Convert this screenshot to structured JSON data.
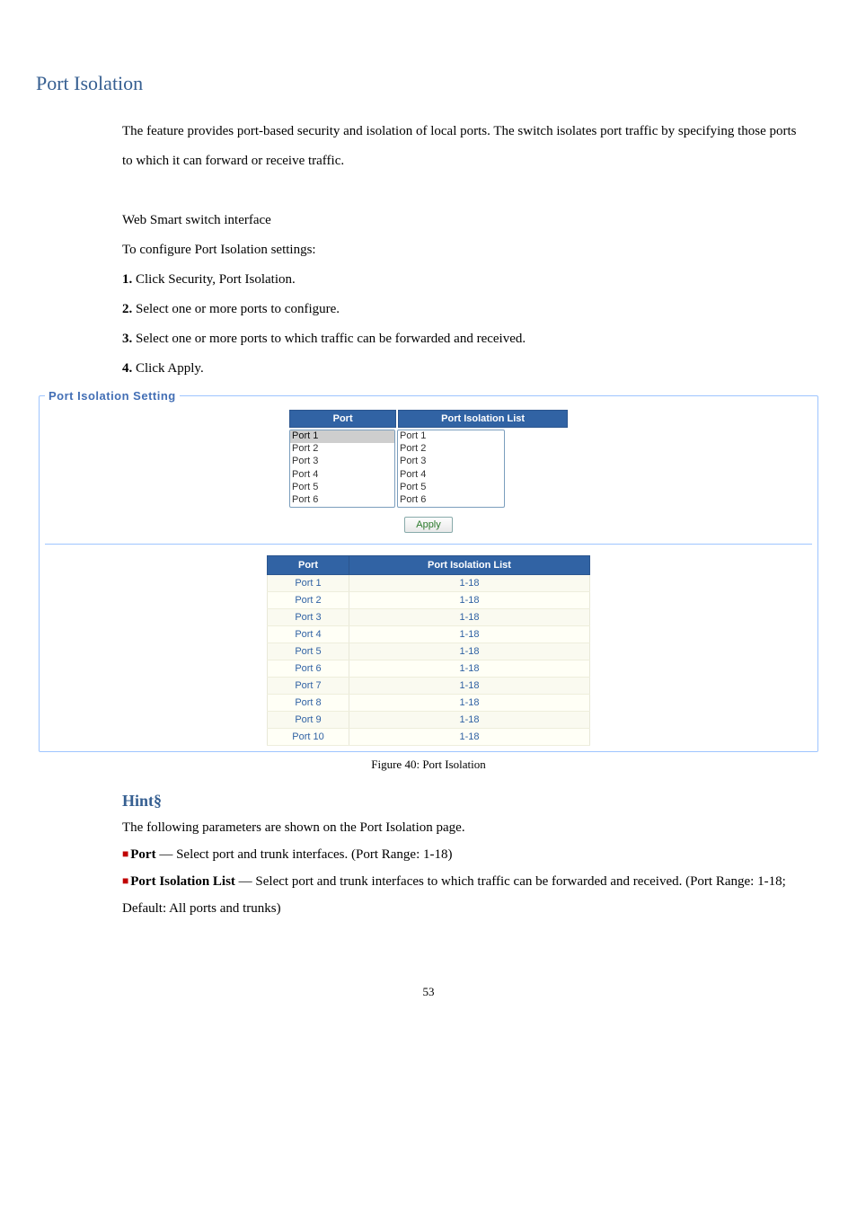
{
  "heading": "Port Isolation",
  "intro": "The feature provides port-based security and isolation of local ports. The switch isolates port traffic by specifying those ports to which it can forward or receive traffic.",
  "interface_label": "Web Smart switch interface",
  "config_lead": "To configure Port Isolation settings:",
  "steps": [
    {
      "num": "1.",
      "text": " Click Security, Port Isolation."
    },
    {
      "num": "2.",
      "text": " Select one or more ports to configure."
    },
    {
      "num": "3.",
      "text": " Select one or more ports to which traffic can be forwarded and received."
    },
    {
      "num": "4.",
      "text": " Click Apply."
    }
  ],
  "fieldset_legend": "Port Isolation Setting",
  "col_port": "Port",
  "col_list": "Port Isolation List",
  "port_options": [
    "Port 1",
    "Port 2",
    "Port 3",
    "Port 4",
    "Port 5",
    "Port 6"
  ],
  "list_options": [
    "Port 1",
    "Port 2",
    "Port 3",
    "Port 4",
    "Port 5",
    "Port 6"
  ],
  "apply_label": "Apply",
  "status_header_port": "Port",
  "status_header_list": "Port Isolation List",
  "status_rows": [
    {
      "port": "Port 1",
      "list": "1-18"
    },
    {
      "port": "Port 2",
      "list": "1-18"
    },
    {
      "port": "Port 3",
      "list": "1-18"
    },
    {
      "port": "Port 4",
      "list": "1-18"
    },
    {
      "port": "Port 5",
      "list": "1-18"
    },
    {
      "port": "Port 6",
      "list": "1-18"
    },
    {
      "port": "Port 7",
      "list": "1-18"
    },
    {
      "port": "Port 8",
      "list": "1-18"
    },
    {
      "port": "Port 9",
      "list": "1-18"
    },
    {
      "port": "Port 10",
      "list": "1-18"
    }
  ],
  "figure_caption": "Figure 40: Port Isolation",
  "hint_heading": "Hint§",
  "hint_lead": "The following parameters are shown on the Port Isolation page.",
  "hint_items": [
    {
      "name": "Port",
      "desc": " — Select port and trunk interfaces. (Port Range: 1-18)"
    },
    {
      "name": "Port Isolation List",
      "desc": " — Select port and trunk interfaces to which traffic can be forwarded and received. (Port Range: 1-18; Default: All ports and trunks)"
    }
  ],
  "page_number": "53"
}
